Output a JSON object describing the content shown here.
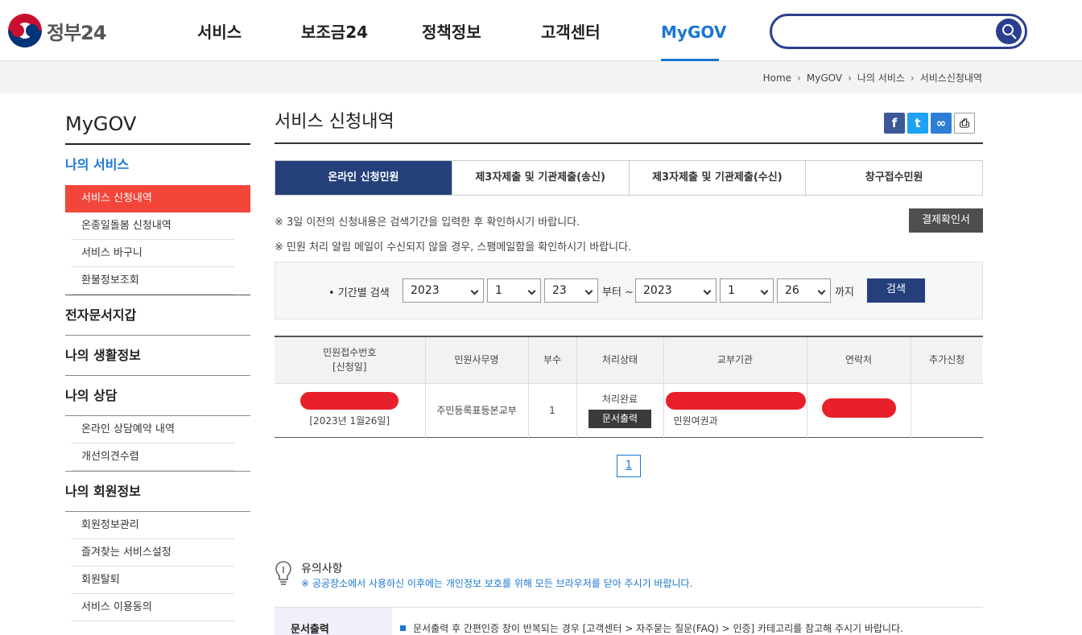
{
  "header": {
    "logo_text": "정부24",
    "nav": [
      "서비스",
      "보조금24",
      "정책정보",
      "고객센터",
      "MyGOV"
    ],
    "active_nav": "MyGOV",
    "search_placeholder": ""
  },
  "breadcrumb": [
    "Home",
    "MyGOV",
    "나의 서비스",
    "서비스신청내역"
  ],
  "lnb": {
    "title": "MyGOV",
    "section_my_service": "나의 서비스",
    "my_service_items": [
      "서비스 신청내역",
      "온종일돌봄 신청내역",
      "서비스 바구니",
      "환불정보조회"
    ],
    "section_wallet": "전자문서지갑",
    "section_life": "나의 생활정보",
    "section_consult": "나의 상담",
    "consult_items": [
      "온라인 상담예약 내역",
      "개선의견수렴"
    ],
    "section_member": "나의 회원정보",
    "member_items": [
      "회원정보관리",
      "즐겨찾는 서비스설정",
      "회원탈퇴",
      "서비스 이용동의"
    ]
  },
  "content": {
    "title": "서비스 신청내역",
    "tabs": [
      "온라인 신청민원",
      "제3자제출 및 기관제출(송신)",
      "제3자제출 및 기관제출(수신)",
      "창구접수민원"
    ],
    "notice1": "※ 3일 이전의 신청내용은 검색기간을 입력한 후 확인하시기 바랍니다.",
    "notice2": "※ 민원 처리 알림 메일이 수신되지 않을 경우, 스팸메일함을 확인하시기 바랍니다.",
    "confirm_button": "결제확인서",
    "search": {
      "label": "• 기간별 검색",
      "from_year": "2023",
      "from_month": "1",
      "from_day": "23",
      "from_text": "부터 ~",
      "to_year": "2023",
      "to_month": "1",
      "to_day": "26",
      "to_text": "까지",
      "button": "검색"
    },
    "table": {
      "headers": [
        "민원접수번호",
        "[신청일]",
        "민원사무명",
        "부수",
        "처리상태",
        "교부기관",
        "연락처",
        "추가신청"
      ],
      "row": {
        "date": "[2023년 1월26일]",
        "service": "주민등록표등본교부",
        "copies": "1",
        "status": "처리완료",
        "print_button": "문서출력",
        "agency": "민원여권과"
      }
    },
    "page": "1",
    "caution_title": "유의사항",
    "caution_text": "※ 공공장소에서 사용하신 이후에는 개인정보 보호를 위해 모든 브라우저를 닫아 주시기 바랍니다.",
    "print_head": "문서출력",
    "print_text": "문서출력 후 간편인증 창이 반복되는 경우 [고객센터 > 자주묻는 질문(FAQ) > 인증] 카테고리를 참고해 주시기 바랍니다."
  }
}
